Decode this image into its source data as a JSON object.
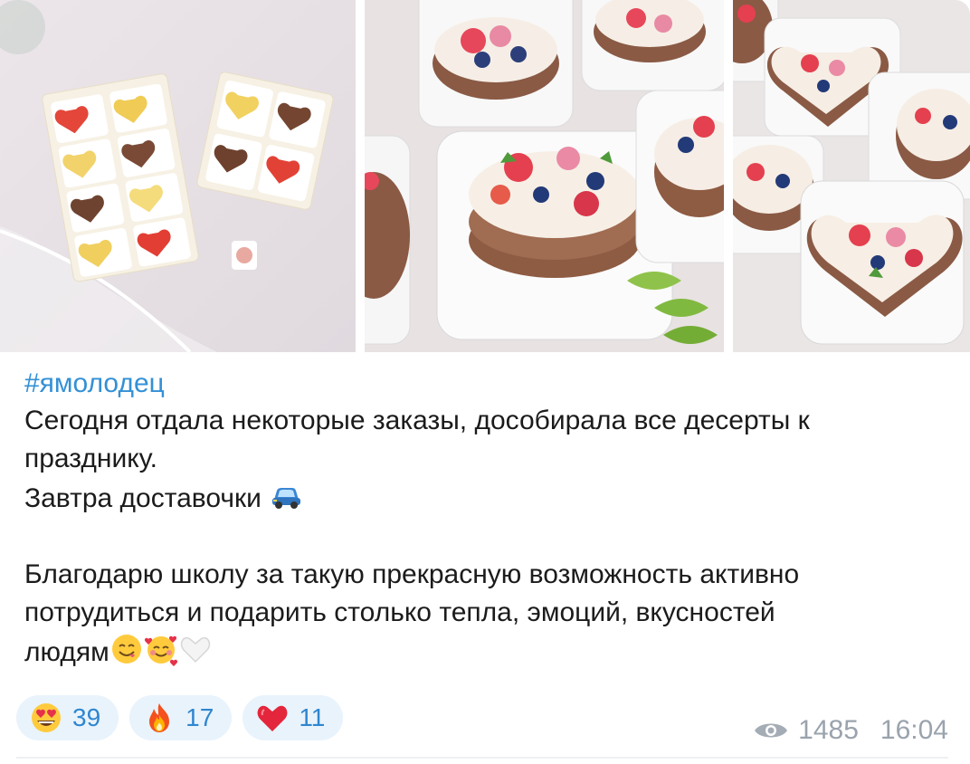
{
  "post": {
    "photos": [
      {
        "name": "heart-candies-photo"
      },
      {
        "name": "heart-cakes-photo"
      },
      {
        "name": "boxed-cakes-photo"
      }
    ],
    "hashtag": "#ямолодец",
    "lines": [
      "Сегодня отдала некоторые заказы, дособирала все десерты к",
      "празднику.",
      "Завтра доставочки",
      "",
      "Благодарю школу за такую прекрасную возможность активно",
      "потрудиться и подарить столько тепла, эмоций, вкусностей",
      "людям"
    ],
    "emojis": {
      "line3": "car-icon",
      "line7": [
        "yum-face-icon",
        "smiling-hearts-face-icon",
        "white-heart-icon"
      ]
    },
    "reactions": [
      {
        "icon": "heart-eyes-face-icon",
        "count": "39"
      },
      {
        "icon": "fire-icon",
        "count": "17"
      },
      {
        "icon": "red-heart-icon",
        "count": "11"
      }
    ],
    "views": "1485",
    "time": "16:04",
    "colors": {
      "link": "#3390d6",
      "reaction_bg": "#e9f3fc",
      "reaction_text": "#2f86cf",
      "meta_text": "#9aa3ad"
    }
  }
}
